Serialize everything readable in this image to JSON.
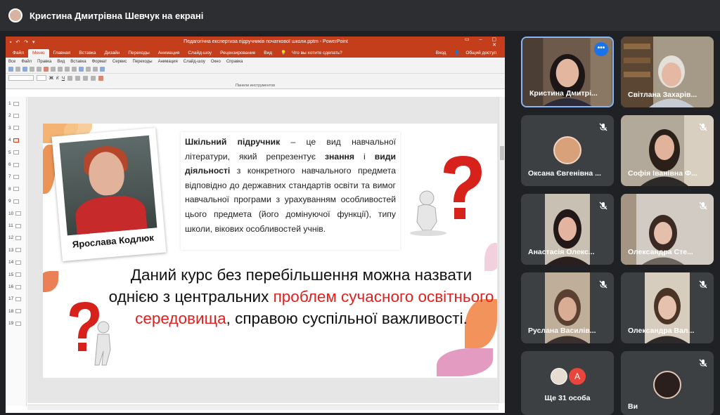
{
  "meet": {
    "presenter_title": "Кристина Дмитрівна Шевчук на екрані"
  },
  "powerpoint": {
    "window_title": "Педагогічна експертиза підручників початкової школи.pptm - PowerPoint",
    "tabs": [
      "Файл",
      "Меню",
      "Главная",
      "Вставка",
      "Дизайн",
      "Переходы",
      "Анимация",
      "Слайд-шоу",
      "Рецензирование",
      "Вид"
    ],
    "active_tab": "Меню",
    "tell_me": "Что вы хотите сделать?",
    "signin": "Вход",
    "share": "Общий доступ",
    "menu_items": [
      "Все",
      "Файл",
      "Правка",
      "Вид",
      "Вставка",
      "Формат",
      "Сервис",
      "Переходы",
      "Анимация",
      "Слайд-шоу",
      "Окно",
      "Справка"
    ],
    "toolbar_label": "Панели инструментов",
    "slide_numbers": [
      "1",
      "2",
      "3",
      "4",
      "5",
      "6",
      "7",
      "8",
      "9",
      "10",
      "11",
      "12",
      "13",
      "14",
      "15",
      "16",
      "17",
      "18",
      "19"
    ],
    "active_slide": "4"
  },
  "slide": {
    "caption": "Ярослава Кодлюк",
    "definition": {
      "term": "Шкільний підручник",
      "part1": " – це вид навчальної літератури, який репрезентує ",
      "bold2": "знання",
      "part2": " і ",
      "bold3": "види діяльності",
      "part3": " з конкретного навчального предмета відповідно до державних стандартів освіти та вимог навчальної програми з урахуванням особливостей цього предмета (його домінуючої функції), типу школи, вікових особливостей учнів."
    },
    "statement": {
      "part1": "Даний курс без перебільшення можна назвати однією з центральних ",
      "highlight": "проблем сучасного освітнього середовища",
      "part2": ", справою суспільної важливості."
    }
  },
  "participants": [
    {
      "name": "Кристина Дмитрі...",
      "speaking": true
    },
    {
      "name": "Світлана Захарів..."
    },
    {
      "name": "Оксана Євгенівна ...",
      "muted": true
    },
    {
      "name": "Софія Іванівна Ф...",
      "muted": true
    },
    {
      "name": "Анастасія Олекс...",
      "muted": true
    },
    {
      "name": "Олександра Сте...",
      "muted": true
    },
    {
      "name": "Руслана Василів...",
      "muted": true
    },
    {
      "name": "Олександра Вал...",
      "muted": true
    },
    {
      "name": "Ще 31 особа",
      "avatar_letter": "А"
    },
    {
      "name": "Ви",
      "muted": true
    }
  ],
  "colors": {
    "ppt_accent": "#c43e1c",
    "meet_bg": "#202124",
    "tile_bg": "#3c4043",
    "speaking_border": "#8ab4f8",
    "highlight_red": "#e02020"
  },
  "icons": [
    "mic-off-icon",
    "more-options-icon",
    "question-mark-icon"
  ]
}
